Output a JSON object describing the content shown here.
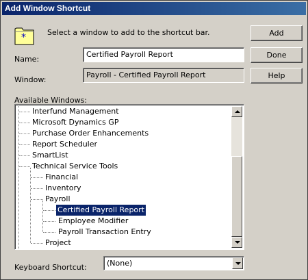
{
  "window": {
    "title": "Add Window Shortcut"
  },
  "instruction": "Select a window to add to the shortcut bar.",
  "buttons": {
    "add": "Add",
    "done": "Done",
    "help": "Help"
  },
  "name_field": {
    "label": "Name:",
    "value": "Certified Payroll Report"
  },
  "window_field": {
    "label": "Window:",
    "value": "Payroll - Certified Payroll Report"
  },
  "available": {
    "label": "Available Windows:",
    "items": [
      {
        "label": "Interfund Management"
      },
      {
        "label": "Microsoft Dynamics GP"
      },
      {
        "label": "Purchase Order Enhancements"
      },
      {
        "label": "Report Scheduler"
      },
      {
        "label": "SmartList"
      },
      {
        "label": "Technical Service Tools"
      },
      {
        "label": "Financial"
      },
      {
        "label": "Inventory"
      },
      {
        "label": "Payroll"
      },
      {
        "label": "Certified Payroll Report"
      },
      {
        "label": "Employee Modifier"
      },
      {
        "label": "Payroll Transaction Entry"
      },
      {
        "label": "Project"
      }
    ],
    "selected": "Certified Payroll Report"
  },
  "keyboard_shortcut": {
    "label": "Keyboard Shortcut:",
    "value": "(None)"
  },
  "colors": {
    "titlebar_start": "#0a246a",
    "titlebar_end": "#3a6ea5",
    "selection": "#0a246a",
    "face": "#d4d0c8"
  }
}
